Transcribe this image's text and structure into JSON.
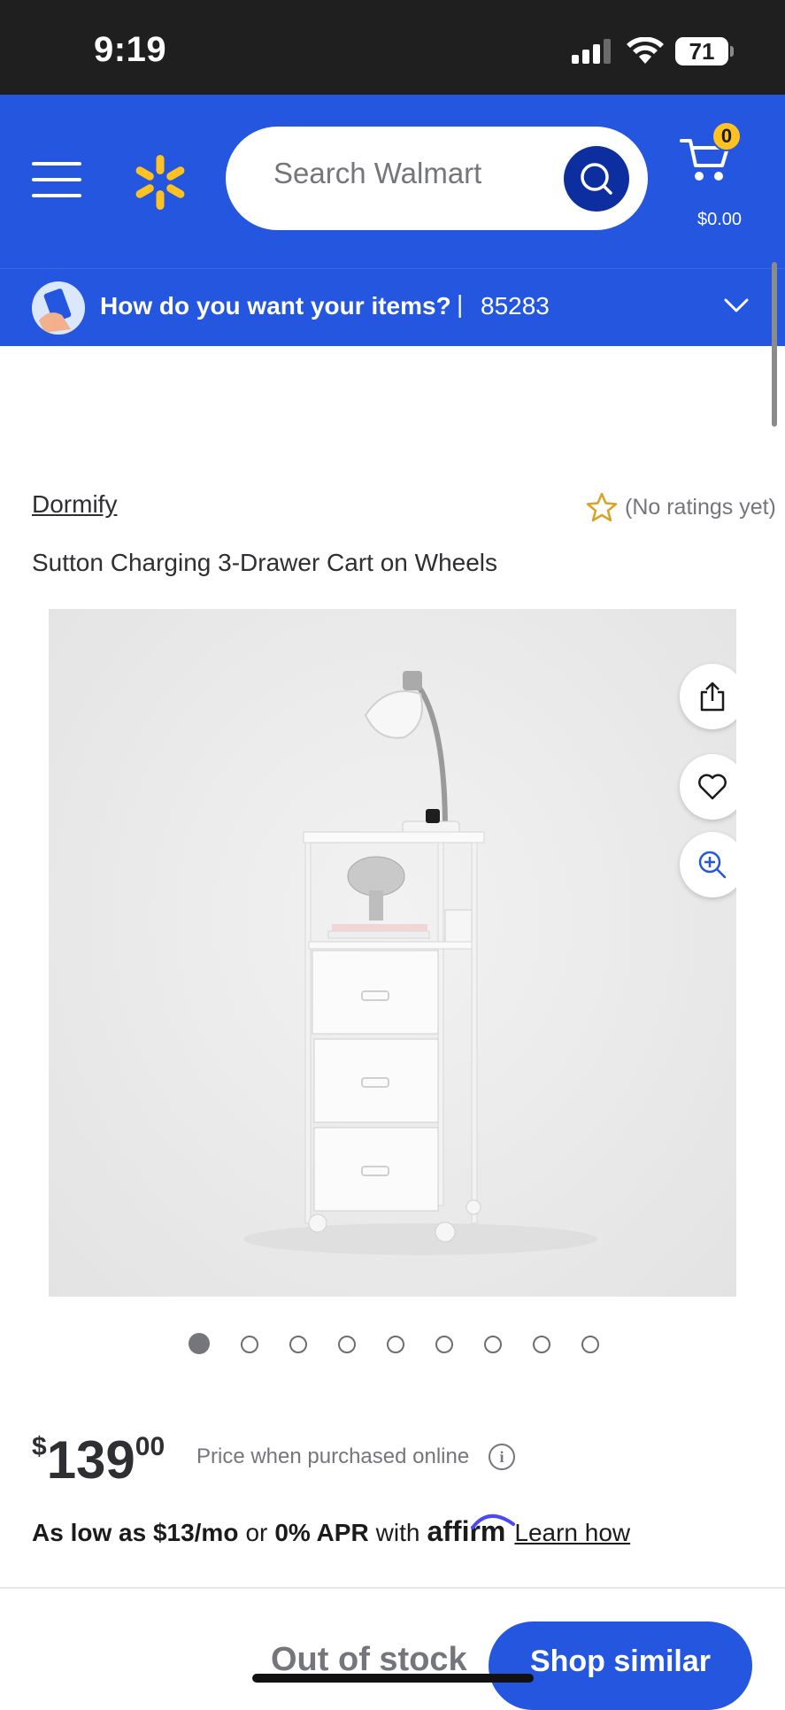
{
  "status_bar": {
    "time": "9:19",
    "battery": "71"
  },
  "header": {
    "search_placeholder": "Search Walmart",
    "cart_count": "0",
    "cart_total": "$0.00"
  },
  "fulfillment": {
    "question": "How do you want your items?",
    "separator": "|",
    "zip": "85283"
  },
  "product": {
    "brand": "Dormify",
    "rating_text": "(No ratings yet)",
    "title": "Sutton Charging 3-Drawer Cart on Wheels",
    "image_count": 9,
    "active_image_index": 0
  },
  "price": {
    "currency": "$",
    "dollars": "139",
    "cents": "00",
    "note": "Price when purchased online",
    "info_symbol": "i"
  },
  "financing": {
    "prefix": "As low as $13/mo",
    "or": "or",
    "apr": "0% APR",
    "with": "with",
    "provider": "affirm",
    "link": "Learn how"
  },
  "actions": {
    "status": "Out of stock",
    "shop_similar": "Shop similar"
  },
  "colors": {
    "brand_blue": "#2456e0",
    "spark_yellow": "#ffc220",
    "affirm_purple": "#4a4af4"
  }
}
